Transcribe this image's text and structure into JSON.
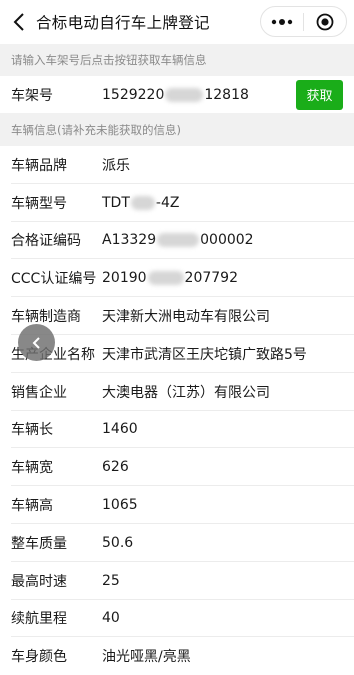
{
  "nav": {
    "title": "合标电动自行车上牌登记",
    "back_icon": "chevron-left-icon",
    "more_icon": "more-dots-icon",
    "close_icon": "target-close-icon"
  },
  "frame_section": {
    "hint": "请输入车架号后点击按钮获取车辆信息",
    "label": "车架号",
    "value_prefix": "1529220",
    "value_suffix": "12818",
    "button_label": "获取",
    "button_color": "#1aad19"
  },
  "info_section": {
    "hint": "车辆信息(请补充未能获取的信息)",
    "rows": [
      {
        "label": "车辆品牌",
        "value": "派乐"
      },
      {
        "label": "车辆型号",
        "value": "TDT",
        "value_suffix": "-4Z"
      },
      {
        "label": "合格证编码",
        "value": "A13329",
        "value_suffix": "000002"
      },
      {
        "label": "CCC认证编号",
        "value": "20190",
        "value_suffix": "207792"
      },
      {
        "label": "车辆制造商",
        "value": "天津新大洲电动车有限公司"
      },
      {
        "label": "生产企业名称",
        "value": "天津市武清区王庆坨镇广致路5号"
      },
      {
        "label": "销售企业",
        "value": "大澳电器（江苏）有限公司"
      },
      {
        "label": "车辆长",
        "value": "1460"
      },
      {
        "label": "车辆宽",
        "value": "626"
      },
      {
        "label": "车辆高",
        "value": "1065"
      },
      {
        "label": "整车质量",
        "value": "50.6"
      },
      {
        "label": "最高时速",
        "value": "25"
      },
      {
        "label": "续航里程",
        "value": "40"
      },
      {
        "label": "车身颜色",
        "value": "油光哑黑/亮黑"
      }
    ]
  },
  "floating_back_icon": "floating-back-arrow-icon"
}
